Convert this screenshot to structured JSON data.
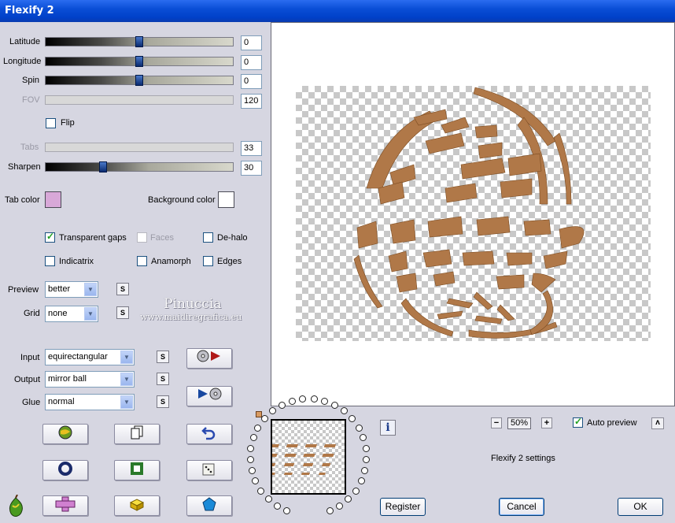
{
  "window": {
    "title": "Flexify 2"
  },
  "sliders": [
    {
      "label": "Latitude",
      "value": "0",
      "enabled": true,
      "level": 0.5
    },
    {
      "label": "Longitude",
      "value": "0",
      "enabled": true,
      "level": 0.5
    },
    {
      "label": "Spin",
      "value": "0",
      "enabled": true,
      "level": 0.5
    },
    {
      "label": "FOV",
      "value": "120",
      "enabled": false
    },
    {
      "label": "Tabs",
      "value": "33",
      "enabled": false
    },
    {
      "label": "Sharpen",
      "value": "30",
      "enabled": true,
      "level": 0.3
    }
  ],
  "flip": {
    "label": "Flip",
    "checked": false
  },
  "colors": {
    "tab_color_label": "Tab color",
    "tab_color": "#d8a8d8",
    "background_color_label": "Background color",
    "background_color": "#ffffff"
  },
  "options": {
    "transparent_gaps": {
      "label": "Transparent gaps",
      "checked": true
    },
    "faces": {
      "label": "Faces",
      "checked": false
    },
    "dehalo": {
      "label": "De-halo",
      "checked": false
    },
    "indicatrix": {
      "label": "Indicatrix",
      "checked": false
    },
    "anamorph": {
      "label": "Anamorph",
      "checked": false
    },
    "edges": {
      "label": "Edges",
      "checked": false
    }
  },
  "preview_select": {
    "label": "Preview",
    "value": "better"
  },
  "grid_select": {
    "label": "Grid",
    "value": "none"
  },
  "input_select": {
    "label": "Input",
    "value": "equirectangular"
  },
  "output_select": {
    "label": "Output",
    "value": "mirror ball"
  },
  "glue_select": {
    "label": "Glue",
    "value": "normal"
  },
  "s_button": "S",
  "watermark": {
    "name": "Pinuccia",
    "url": "www.maidiregrafica.eu"
  },
  "zoom": {
    "minus": "−",
    "value": "50%",
    "plus": "+"
  },
  "auto_preview": {
    "label": "Auto preview",
    "checked": true
  },
  "settings_name": "Flexify 2 settings",
  "buttons": {
    "register": "Register",
    "cancel": "Cancel",
    "ok": "OK",
    "info": "i",
    "up": "ʌ"
  },
  "accent": "#0a4ed6",
  "preview_art_color": "#b07848"
}
